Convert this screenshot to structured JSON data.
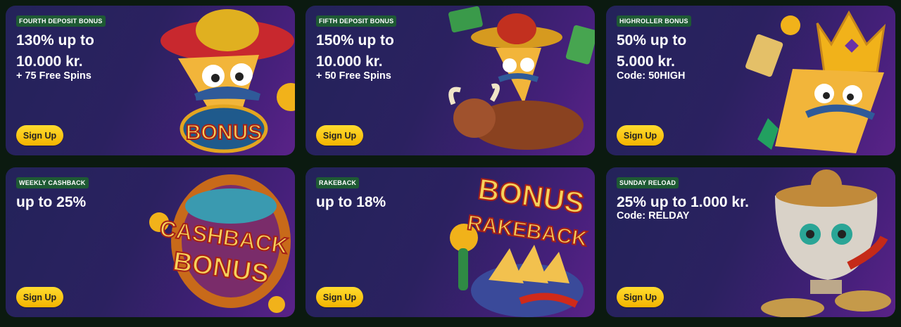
{
  "cards": [
    {
      "badge": "FOURTH DEPOSIT BONUS",
      "line1": "130% up to",
      "line2": "10.000 kr.",
      "sub": "+ 75 Free Spins",
      "button": "Sign Up",
      "art_text": "BONUS"
    },
    {
      "badge": "FIFTH DEPOSIT BONUS",
      "line1": "150% up to",
      "line2": "10.000 kr.",
      "sub": "+ 50 Free Spins",
      "button": "Sign Up"
    },
    {
      "badge": "HIGHROLLER BONUS",
      "line1": "50% up to",
      "line2": "5.000 kr.",
      "sub": "Code: 50HIGH",
      "button": "Sign Up"
    },
    {
      "badge": "WEEKLY CASHBACK",
      "line1": "up to 25%",
      "button": "Sign Up",
      "art_text1": "CASHBACK",
      "art_text2": "BONUS"
    },
    {
      "badge": "RAKEBACK",
      "line1": "up to 18%",
      "button": "Sign Up",
      "art_text1": "BONUS",
      "art_text2": "RAKEBACK"
    },
    {
      "badge": "SUNDAY RELOAD",
      "line1": "25% up to 1.000 kr.",
      "sub": "Code: RELDAY",
      "button": "Sign Up"
    }
  ],
  "colors": {
    "page_bg": "#0b1a10",
    "badge_bg": "#1e5a34",
    "button": "#f7c100"
  }
}
